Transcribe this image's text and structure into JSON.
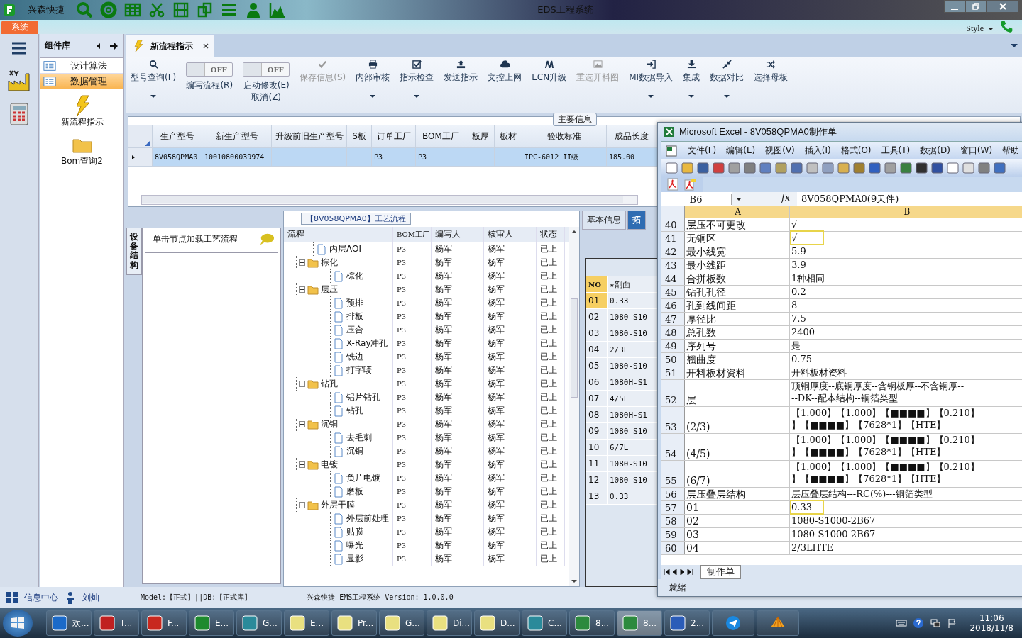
{
  "app": {
    "name": "兴森快捷",
    "title": "EDS工程系统",
    "menu_tab": "系统",
    "style_label": "Style"
  },
  "component_panel": {
    "title": "组件库",
    "items": [
      {
        "label": "设计算法",
        "selected": false
      },
      {
        "label": "数据管理",
        "selected": true
      }
    ],
    "tools": [
      {
        "kind": "bolt",
        "label": "新流程指示"
      },
      {
        "kind": "folder",
        "label": "Bom查询2"
      }
    ]
  },
  "doc_tab": {
    "label": "新流程指示"
  },
  "ribbon": [
    {
      "kind": "button",
      "label": "型号查询(F)",
      "disabled": false,
      "dropdown": true
    },
    {
      "kind": "toggle",
      "label": "编写流程(R)",
      "switch_text": "OFF",
      "on": false
    },
    {
      "kind": "toggle",
      "label": "启动修改(E)\n取消(Z)",
      "switch_text": "OFF",
      "on": false
    },
    {
      "kind": "button",
      "label": "保存信息(S)",
      "disabled": true,
      "dropdown": false
    },
    {
      "kind": "button",
      "label": "内部审核",
      "disabled": false,
      "dropdown": true
    },
    {
      "kind": "button",
      "label": "指示检查",
      "disabled": false,
      "dropdown": true
    },
    {
      "kind": "button",
      "label": "发送指示",
      "disabled": false,
      "dropdown": false
    },
    {
      "kind": "button",
      "label": "文控上网",
      "disabled": false,
      "dropdown": false
    },
    {
      "kind": "button",
      "label": "ECN升级",
      "disabled": false,
      "dropdown": false
    },
    {
      "kind": "button",
      "label": "重选开料图",
      "disabled": true,
      "dropdown": false
    },
    {
      "kind": "button",
      "label": "MI数据导入",
      "disabled": false,
      "dropdown": true
    },
    {
      "kind": "button",
      "label": "集成",
      "disabled": false,
      "dropdown": true
    },
    {
      "kind": "button",
      "label": "数据对比",
      "disabled": false,
      "dropdown": true
    },
    {
      "kind": "button",
      "label": "选择母板",
      "disabled": false,
      "dropdown": false
    }
  ],
  "main_info": {
    "title": "主要信息",
    "columns": [
      "生产型号",
      "新生产型号",
      "升级前旧生产型号",
      "S板",
      "订单工厂",
      "BOM工厂",
      "板厚",
      "板材",
      "验收标准",
      "成品长度"
    ],
    "rows": [
      {
        "selected": true,
        "cells": [
          "8V058QPMA0",
          "10010800039974",
          "",
          "",
          "P3",
          "P3",
          "",
          "",
          "IPC-6012 II级",
          "185.00"
        ]
      }
    ]
  },
  "process_panel": {
    "side_tab": "设备结构",
    "header": "单击节点加载工艺流程"
  },
  "flow": {
    "title": "【8V058QPMA0】工艺流程",
    "columns": [
      "流程",
      "BOM工厂",
      "编写人",
      "核审人",
      "状态"
    ],
    "tree": [
      {
        "kind": "file",
        "label": "内层AOI",
        "bom": "P3",
        "writer": "杨军",
        "reviewer": "杨军",
        "status": "已上"
      },
      {
        "kind": "folder",
        "label": "棕化",
        "bom": "P3",
        "writer": "杨军",
        "reviewer": "杨军",
        "status": "已上",
        "expanded": true,
        "children": [
          {
            "kind": "file",
            "label": "棕化",
            "bom": "P3",
            "writer": "杨军",
            "reviewer": "杨军",
            "status": "已上"
          }
        ]
      },
      {
        "kind": "folder",
        "label": "层压",
        "bom": "P3",
        "writer": "杨军",
        "reviewer": "杨军",
        "status": "已上",
        "expanded": true,
        "children": [
          {
            "kind": "file",
            "label": "预排",
            "bom": "P3",
            "writer": "杨军",
            "reviewer": "杨军",
            "status": "已上"
          },
          {
            "kind": "file",
            "label": "排板",
            "bom": "P3",
            "writer": "杨军",
            "reviewer": "杨军",
            "status": "已上"
          },
          {
            "kind": "file",
            "label": "压合",
            "bom": "P3",
            "writer": "杨军",
            "reviewer": "杨军",
            "status": "已上"
          },
          {
            "kind": "file",
            "label": "X-Ray冲孔",
            "bom": "P3",
            "writer": "杨军",
            "reviewer": "杨军",
            "status": "已上"
          },
          {
            "kind": "file",
            "label": "铣边",
            "bom": "P3",
            "writer": "杨军",
            "reviewer": "杨军",
            "status": "已上"
          },
          {
            "kind": "file",
            "label": "打字唛",
            "bom": "P3",
            "writer": "杨军",
            "reviewer": "杨军",
            "status": "已上"
          }
        ]
      },
      {
        "kind": "folder",
        "label": "钻孔",
        "bom": "P3",
        "writer": "杨军",
        "reviewer": "杨军",
        "status": "已上",
        "expanded": true,
        "children": [
          {
            "kind": "file",
            "label": "铝片钻孔",
            "bom": "P3",
            "writer": "杨军",
            "reviewer": "杨军",
            "status": "已上"
          },
          {
            "kind": "file",
            "label": "钻孔",
            "bom": "P3",
            "writer": "杨军",
            "reviewer": "杨军",
            "status": "已上"
          }
        ]
      },
      {
        "kind": "folder",
        "label": "沉铜",
        "bom": "P3",
        "writer": "杨军",
        "reviewer": "杨军",
        "status": "已上",
        "expanded": true,
        "children": [
          {
            "kind": "file",
            "label": "去毛刺",
            "bom": "P3",
            "writer": "杨军",
            "reviewer": "杨军",
            "status": "已上"
          },
          {
            "kind": "file",
            "label": "沉铜",
            "bom": "P3",
            "writer": "杨军",
            "reviewer": "杨军",
            "status": "已上"
          }
        ]
      },
      {
        "kind": "folder",
        "label": "电镀",
        "bom": "P3",
        "writer": "杨军",
        "reviewer": "杨军",
        "status": "已上",
        "expanded": true,
        "children": [
          {
            "kind": "file",
            "label": "负片电镀",
            "bom": "P3",
            "writer": "杨军",
            "reviewer": "杨军",
            "status": "已上"
          },
          {
            "kind": "file",
            "label": "磨板",
            "bom": "P3",
            "writer": "杨军",
            "reviewer": "杨军",
            "status": "已上"
          }
        ]
      },
      {
        "kind": "folder",
        "label": "外层干膜",
        "bom": "P3",
        "writer": "杨军",
        "reviewer": "杨军",
        "status": "已上",
        "expanded": true,
        "children": [
          {
            "kind": "file",
            "label": "外层前处理",
            "bom": "P3",
            "writer": "杨军",
            "reviewer": "杨军",
            "status": "已上"
          },
          {
            "kind": "file",
            "label": "贴膜",
            "bom": "P3",
            "writer": "杨军",
            "reviewer": "杨军",
            "status": "已上"
          },
          {
            "kind": "file",
            "label": "曝光",
            "bom": "P3",
            "writer": "杨军",
            "reviewer": "杨军",
            "status": "已上"
          },
          {
            "kind": "file",
            "label": "显影",
            "bom": "P3",
            "writer": "杨军",
            "reviewer": "杨军",
            "status": "已上"
          }
        ]
      }
    ]
  },
  "side_panel": {
    "tabs": [
      {
        "label": "基本信息",
        "selected": false
      },
      {
        "label": "拓",
        "selected": true
      }
    ],
    "columns": [
      "NO",
      "★剖面"
    ],
    "rows": [
      {
        "no": "01",
        "value": "0.33",
        "selected": true
      },
      {
        "no": "02",
        "value": "1080-S10",
        "selected": false
      },
      {
        "no": "03",
        "value": "1080-S10",
        "selected": false
      },
      {
        "no": "04",
        "value": "2/3L",
        "selected": false
      },
      {
        "no": "05",
        "value": "1080-S10",
        "selected": false
      },
      {
        "no": "06",
        "value": "1080H-S1",
        "selected": false
      },
      {
        "no": "07",
        "value": "4/5L",
        "selected": false
      },
      {
        "no": "08",
        "value": "1080H-S1",
        "selected": false
      },
      {
        "no": "09",
        "value": "1080-S10",
        "selected": false
      },
      {
        "no": "10",
        "value": "6/7L",
        "selected": false
      },
      {
        "no": "11",
        "value": "1080-S10",
        "selected": false
      },
      {
        "no": "12",
        "value": "1080-S10",
        "selected": false
      },
      {
        "no": "13",
        "value": "0.33",
        "selected": false
      }
    ]
  },
  "status_bar": {
    "info": "信息中心",
    "user": "刘灿",
    "model": "Model:【正式】||DB:【正式库】",
    "version": "兴森快捷 EMS工程系统 Version: 1.0.0.0"
  },
  "excel": {
    "title": "Microsoft Excel - 8V058QPMA0制作单",
    "menu": [
      "文件(F)",
      "编辑(E)",
      "视图(V)",
      "插入(I)",
      "格式(O)",
      "工具(T)",
      "数据(D)",
      "窗口(W)",
      "帮助"
    ],
    "name_box": "B6",
    "fx_label": "fx",
    "formula": "8V058QPMA0(9天件)",
    "columns": [
      "A",
      "B"
    ],
    "rows": [
      {
        "n": "40",
        "a": "层压不可更改",
        "b": "√",
        "marked": false
      },
      {
        "n": "41",
        "a": "无铜区",
        "b": "√",
        "marked": true
      },
      {
        "n": "42",
        "a": "最小线宽",
        "b": "5.9",
        "marked": false
      },
      {
        "n": "43",
        "a": "最小线距",
        "b": "3.9",
        "marked": false
      },
      {
        "n": "44",
        "a": "合拼板数",
        "b": "1种相同",
        "marked": false
      },
      {
        "n": "45",
        "a": "钻孔孔径",
        "b": "0.2",
        "marked": false
      },
      {
        "n": "46",
        "a": "孔到线间距",
        "b": "8",
        "marked": false
      },
      {
        "n": "47",
        "a": "厚径比",
        "b": "7.5",
        "marked": false
      },
      {
        "n": "48",
        "a": "总孔数",
        "b": "2400",
        "marked": false
      },
      {
        "n": "49",
        "a": "序列号",
        "b": "是",
        "marked": false
      },
      {
        "n": "50",
        "a": "翘曲度",
        "b": "0.75",
        "marked": false
      },
      {
        "n": "51",
        "a": "开料板材资料",
        "b": "开料板材资料",
        "marked": false
      },
      {
        "n": "52",
        "a": "层",
        "b_lines": [
          "顶铜厚度--底铜厚度--含铜板厚--不含铜厚--",
          "--DK--配本结构--铜箔类型"
        ],
        "marked": false
      },
      {
        "n": "53",
        "a": "(2/3)",
        "b_lines": [
          "【1.000】【1.000】【■■■■】【0.210】",
          "】【■■■■】【7628*1】【HTE】"
        ],
        "marked": false
      },
      {
        "n": "54",
        "a": "(4/5)",
        "b_lines": [
          "【1.000】【1.000】【■■■■】【0.210】",
          "】【■■■■】【7628*1】【HTE】"
        ],
        "marked": false
      },
      {
        "n": "55",
        "a": "(6/7)",
        "b_lines": [
          "【1.000】【1.000】【■■■■】【0.210】",
          "】【■■■■】【7628*1】【HTE】"
        ],
        "marked": false
      },
      {
        "n": "56",
        "a": "层压叠层结构",
        "b": "层压叠层结构---RC(%)---铜箔类型",
        "marked": false
      },
      {
        "n": "57",
        "a": "01",
        "b": "0.33",
        "marked": true
      },
      {
        "n": "58",
        "a": "02",
        "b": "1080-S1000-2B67",
        "marked": false
      },
      {
        "n": "59",
        "a": "03",
        "b": "1080-S1000-2B67",
        "marked": false
      },
      {
        "n": "60",
        "a": "04",
        "b": "2/3LHTE",
        "marked": false
      }
    ],
    "sheet_tab": "制作单",
    "status": "就绪"
  },
  "taskbar": {
    "items": [
      {
        "label": "欢...",
        "selected": false
      },
      {
        "label": "T...",
        "selected": false
      },
      {
        "label": "F...",
        "selected": false
      },
      {
        "label": "E...",
        "selected": false
      },
      {
        "label": "G...",
        "selected": false
      },
      {
        "label": "E...",
        "selected": false
      },
      {
        "label": "Pr...",
        "selected": false
      },
      {
        "label": "G...",
        "selected": false
      },
      {
        "label": "Di...",
        "selected": false
      },
      {
        "label": "D...",
        "selected": false
      },
      {
        "label": "C...",
        "selected": false
      },
      {
        "label": "8...",
        "selected": false
      },
      {
        "label": "8...",
        "selected": true
      },
      {
        "label": "2...",
        "selected": false
      }
    ],
    "time": "11:06",
    "date": "2018/11/8"
  }
}
